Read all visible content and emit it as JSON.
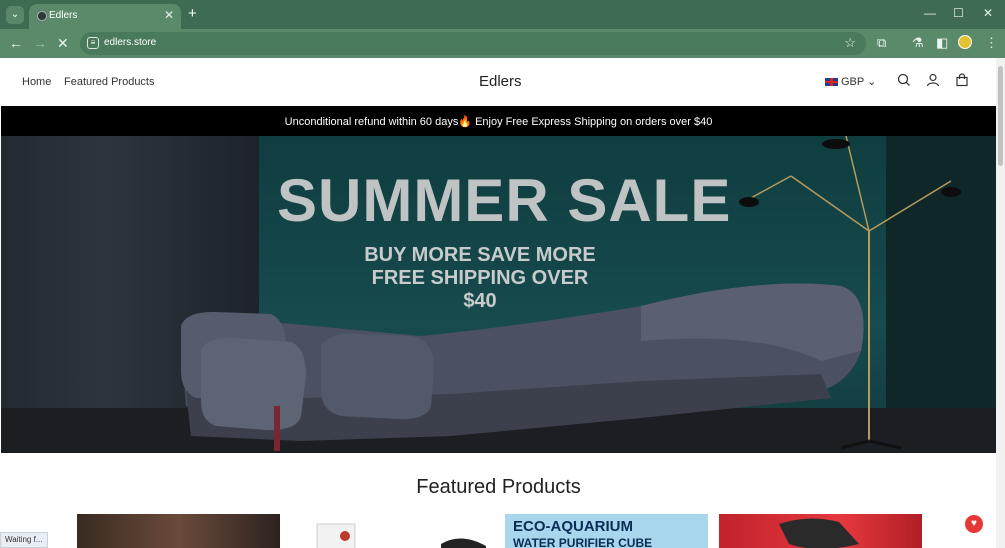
{
  "browser": {
    "tab_title": "Edlers",
    "url": "edlers.store",
    "status_text": "Waiting f...",
    "icons": [
      "chevron-down-icon",
      "close-icon",
      "plus-icon",
      "back-icon",
      "forward-icon",
      "stop-icon",
      "star-icon",
      "extensions-icon",
      "lab-icon",
      "sidebar-icon",
      "profile-icon",
      "menu-icon"
    ]
  },
  "header": {
    "nav": [
      {
        "label": "Home"
      },
      {
        "label": "Featured Products"
      }
    ],
    "brand": "Edlers",
    "currency": "GBP"
  },
  "announcement": {
    "text": "Unconditional refund within 60 days🔥 Enjoy Free Express Shipping on orders over $40"
  },
  "hero": {
    "title": "SUMMER SALE",
    "line1": "BUY MORE SAVE MORE",
    "line2": "FREE SHIPPING OVER $40"
  },
  "featured": {
    "title": "Featured Products",
    "product3_text1": "ECO-AQUARIUM",
    "product3_text2": "WATER PURIFIER CUBE"
  },
  "colors": {
    "browser_frame": "#3e6b52",
    "toolbar": "#5b8a6b",
    "announcement_bg": "#000000",
    "hero_panel": "#174b4d",
    "accent_red": "#e53935"
  }
}
